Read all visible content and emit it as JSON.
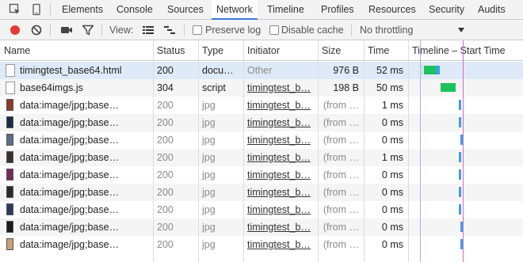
{
  "tabs": [
    {
      "label": "Elements"
    },
    {
      "label": "Console"
    },
    {
      "label": "Sources"
    },
    {
      "label": "Network"
    },
    {
      "label": "Timeline"
    },
    {
      "label": "Profiles"
    },
    {
      "label": "Resources"
    },
    {
      "label": "Security"
    },
    {
      "label": "Audits"
    }
  ],
  "toolbar": {
    "view_label": "View:",
    "preserve_log": "Preserve log",
    "disable_cache": "Disable cache",
    "throttling": "No throttling"
  },
  "columns": {
    "name": "Name",
    "status": "Status",
    "type": "Type",
    "initiator": "Initiator",
    "size": "Size",
    "time": "Time",
    "timeline": "Timeline – Start Time"
  },
  "rows": [
    {
      "name": "timingtest_base64.html",
      "status": "200",
      "type": "docu…",
      "initiator": "Other",
      "size": "976 B",
      "time": "52 ms"
    },
    {
      "name": "base64imgs.js",
      "status": "304",
      "type": "script",
      "initiator": "timingtest_b…",
      "size": "198 B",
      "time": "50 ms"
    },
    {
      "name": "data:image/jpg;base…",
      "status": "200",
      "type": "jpg",
      "initiator": "timingtest_b…",
      "size": "(from …",
      "time": "1 ms"
    },
    {
      "name": "data:image/jpg;base…",
      "status": "200",
      "type": "jpg",
      "initiator": "timingtest_b…",
      "size": "(from …",
      "time": "0 ms"
    },
    {
      "name": "data:image/jpg;base…",
      "status": "200",
      "type": "jpg",
      "initiator": "timingtest_b…",
      "size": "(from …",
      "time": "0 ms"
    },
    {
      "name": "data:image/jpg;base…",
      "status": "200",
      "type": "jpg",
      "initiator": "timingtest_b…",
      "size": "(from …",
      "time": "1 ms"
    },
    {
      "name": "data:image/jpg;base…",
      "status": "200",
      "type": "jpg",
      "initiator": "timingtest_b…",
      "size": "(from …",
      "time": "0 ms"
    },
    {
      "name": "data:image/jpg;base…",
      "status": "200",
      "type": "jpg",
      "initiator": "timingtest_b…",
      "size": "(from …",
      "time": "0 ms"
    },
    {
      "name": "data:image/jpg;base…",
      "status": "200",
      "type": "jpg",
      "initiator": "timingtest_b…",
      "size": "(from …",
      "time": "0 ms"
    },
    {
      "name": "data:image/jpg;base…",
      "status": "200",
      "type": "jpg",
      "initiator": "timingtest_b…",
      "size": "(from …",
      "time": "0 ms"
    },
    {
      "name": "data:image/jpg;base…",
      "status": "200",
      "type": "jpg",
      "initiator": "timingtest_b…",
      "size": "(from …",
      "time": "0 ms"
    }
  ],
  "colors": {
    "accent": "#3879d9",
    "record": "#e53935",
    "wait_bar": "#1bc15a",
    "download_bar": "#3aa0e8",
    "load_line": "#d36bc4"
  }
}
